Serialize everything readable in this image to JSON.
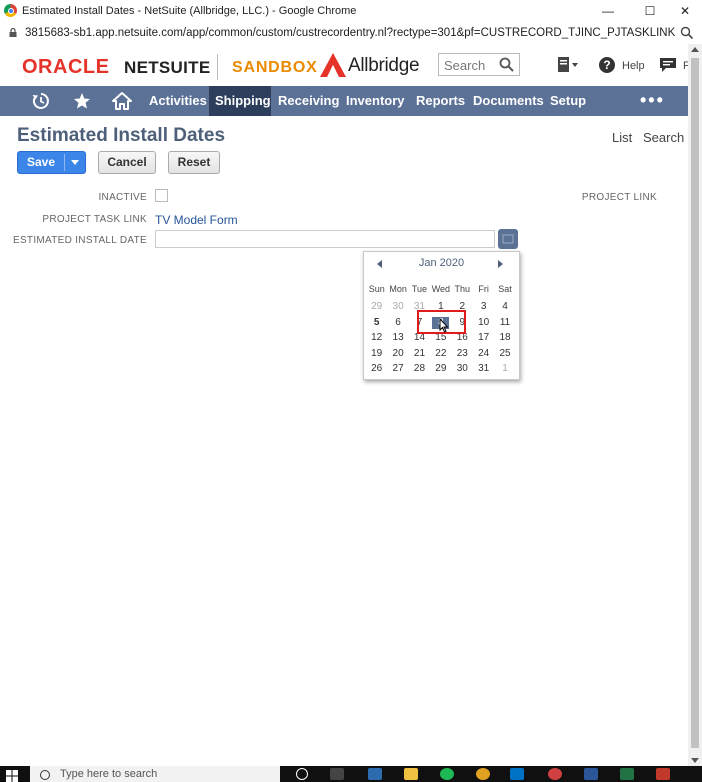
{
  "window": {
    "title": "Estimated Install Dates - NetSuite (Allbridge, LLC.) - Google Chrome",
    "minimize": "—",
    "maximize": "☐",
    "close": "✕"
  },
  "browser": {
    "url": "3815683-sb1.app.netsuite.com/app/common/custom/custrecordentry.nl?rectype=301&pf=CUSTRECORD_TJINC_PJTASKLINKEID&pi=11573..."
  },
  "header": {
    "oracle_brand": "ORACLE",
    "netsuite_brand": "NETSUITE",
    "sandbox_label": "SANDBOX",
    "company_brand": "Allbridge",
    "search_placeholder": "Search",
    "help_label": "Help",
    "truncated_label": "F",
    "colors": {
      "oracle_red": "#e5332a",
      "sandbox_orange": "#e98a00"
    }
  },
  "nav": {
    "items": [
      {
        "label": "Activities",
        "active": false
      },
      {
        "label": "Shipping",
        "active": true
      },
      {
        "label": "Receiving",
        "active": false
      },
      {
        "label": "Inventory",
        "active": false
      },
      {
        "label": "Reports",
        "active": false
      },
      {
        "label": "Documents",
        "active": false
      },
      {
        "label": "Setup",
        "active": false
      }
    ],
    "more": "•••",
    "icons": [
      "recent-icon",
      "star-icon",
      "home-icon"
    ],
    "colors": {
      "bar": "#5b7196",
      "active": "#2d3e5c"
    }
  },
  "page": {
    "title": "Estimated Install Dates",
    "links": {
      "list": "List",
      "search": "Search"
    },
    "buttons": {
      "save": "Save",
      "cancel": "Cancel",
      "reset": "Reset"
    }
  },
  "form": {
    "inactive_label": "INACTIVE",
    "inactive_checked": false,
    "project_link_label": "PROJECT LINK",
    "project_task_link_label": "PROJECT TASK LINK",
    "project_task_link_value": "TV Model Form",
    "estimated_install_date_label": "ESTIMATED INSTALL DATE",
    "estimated_install_date_value": ""
  },
  "calendar": {
    "month_label": "Jan 2020",
    "weekdays": [
      "Sun",
      "Mon",
      "Tue",
      "Wed",
      "Thu",
      "Fri",
      "Sat"
    ],
    "weeks": [
      [
        {
          "d": "29",
          "m": true
        },
        {
          "d": "30",
          "m": true
        },
        {
          "d": "31",
          "m": true
        },
        {
          "d": "1"
        },
        {
          "d": "2"
        },
        {
          "d": "3"
        },
        {
          "d": "4"
        }
      ],
      [
        {
          "d": "5",
          "today": true
        },
        {
          "d": "6"
        },
        {
          "d": "7"
        },
        {
          "d": "8",
          "selected": true
        },
        {
          "d": "9"
        },
        {
          "d": "10"
        },
        {
          "d": "11"
        }
      ],
      [
        {
          "d": "12"
        },
        {
          "d": "13"
        },
        {
          "d": "14"
        },
        {
          "d": "15"
        },
        {
          "d": "16"
        },
        {
          "d": "17"
        },
        {
          "d": "18"
        }
      ],
      [
        {
          "d": "19"
        },
        {
          "d": "20"
        },
        {
          "d": "21"
        },
        {
          "d": "22"
        },
        {
          "d": "23"
        },
        {
          "d": "24"
        },
        {
          "d": "25"
        }
      ],
      [
        {
          "d": "26"
        },
        {
          "d": "27"
        },
        {
          "d": "28"
        },
        {
          "d": "29"
        },
        {
          "d": "30"
        },
        {
          "d": "31"
        },
        {
          "d": "1",
          "m": true
        }
      ]
    ],
    "highlight_color": "#e01b1b"
  },
  "taskbar": {
    "search_placeholder": "Type here to search"
  }
}
